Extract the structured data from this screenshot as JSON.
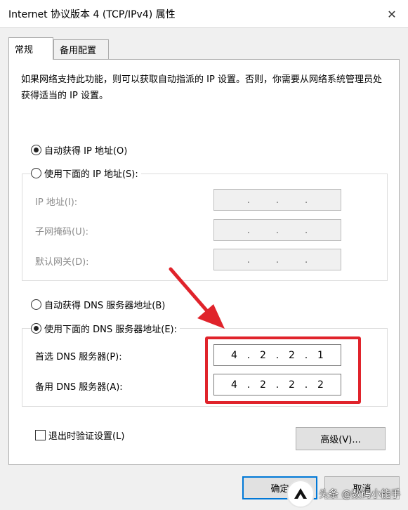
{
  "window": {
    "title": "Internet 协议版本 4 (TCP/IPv4) 属性",
    "close_glyph": "✕"
  },
  "tabs": [
    {
      "label": "常规",
      "active": true
    },
    {
      "label": "备用配置",
      "active": false
    }
  ],
  "description": "如果网络支持此功能，则可以获取自动指派的 IP 设置。否则，你需要从网络系统管理员处获得适当的 IP 设置。",
  "ip_section": {
    "auto_label": "自动获得 IP 地址(O)",
    "auto_selected": true,
    "manual_label": "使用下面的 IP 地址(S):",
    "manual_selected": false,
    "fields": [
      {
        "label": "IP 地址(I):",
        "octets": [
          "",
          "",
          "",
          ""
        ],
        "separator": "."
      },
      {
        "label": "子网掩码(U):",
        "octets": [
          "",
          "",
          "",
          ""
        ],
        "separator": "."
      },
      {
        "label": "默认网关(D):",
        "octets": [
          "",
          "",
          "",
          ""
        ],
        "separator": "."
      }
    ]
  },
  "dns_section": {
    "auto_label": "自动获得 DNS 服务器地址(B)",
    "auto_selected": false,
    "manual_label": "使用下面的 DNS 服务器地址(E):",
    "manual_selected": true,
    "fields": [
      {
        "label": "首选 DNS 服务器(P):",
        "octets": [
          "4",
          "2",
          "2",
          "1"
        ],
        "separator": "."
      },
      {
        "label": "备用 DNS 服务器(A):",
        "octets": [
          "4",
          "2",
          "2",
          "2"
        ],
        "separator": "."
      }
    ]
  },
  "validate_label": "退出时验证设置(L)",
  "validate_checked": false,
  "buttons": {
    "advanced": "高级(V)...",
    "ok": "确定",
    "cancel": "取消"
  },
  "annotation": {
    "color": "#e0232b"
  },
  "watermark": {
    "text": "头条 @数码小能手"
  }
}
